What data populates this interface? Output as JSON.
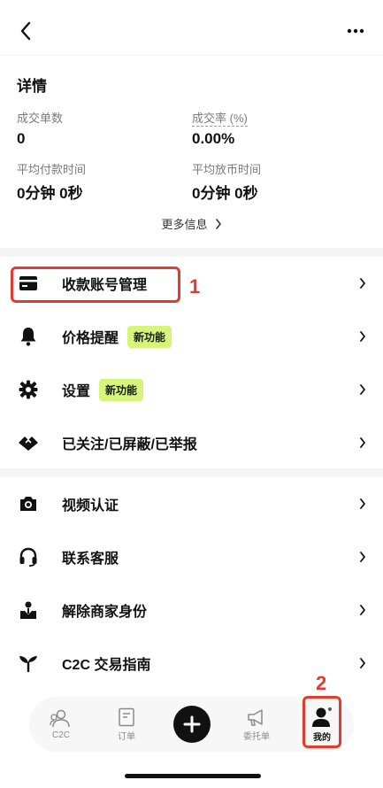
{
  "details": {
    "title": "详情",
    "stats": [
      {
        "label": "成交单数",
        "value": "0"
      },
      {
        "label": "成交率 (%)",
        "value": "0.00%"
      },
      {
        "label": "平均付款时间",
        "value": "0分钟 0秒"
      },
      {
        "label": "平均放币时间",
        "value": "0分钟 0秒"
      }
    ],
    "more_info": "更多信息"
  },
  "menu_section1": [
    {
      "label": "收款账号管理",
      "icon": "card-icon"
    },
    {
      "label": "价格提醒",
      "icon": "bell-icon",
      "badge": "新功能"
    },
    {
      "label": "设置",
      "icon": "gear-icon",
      "badge": "新功能"
    },
    {
      "label": "已关注/已屏蔽/已举报",
      "icon": "handshake-icon"
    }
  ],
  "menu_section2": [
    {
      "label": "视频认证",
      "icon": "camera-icon"
    },
    {
      "label": "联系客服",
      "icon": "headset-icon"
    },
    {
      "label": "解除商家身份",
      "icon": "merchant-icon"
    },
    {
      "label": "C2C 交易指南",
      "icon": "sprout-icon"
    }
  ],
  "annotations": {
    "one": "1",
    "two": "2"
  },
  "tabbar": {
    "tabs": [
      {
        "label": "C2C",
        "icon": "users-icon"
      },
      {
        "label": "订单",
        "icon": "order-icon"
      },
      {
        "label": "",
        "icon": "plus-icon"
      },
      {
        "label": "委托单",
        "icon": "megaphone-icon"
      },
      {
        "label": "我的",
        "icon": "profile-icon",
        "active": true
      }
    ]
  },
  "colors": {
    "accent_badge": "#d6f57a",
    "annotation": "#e33b2e"
  }
}
